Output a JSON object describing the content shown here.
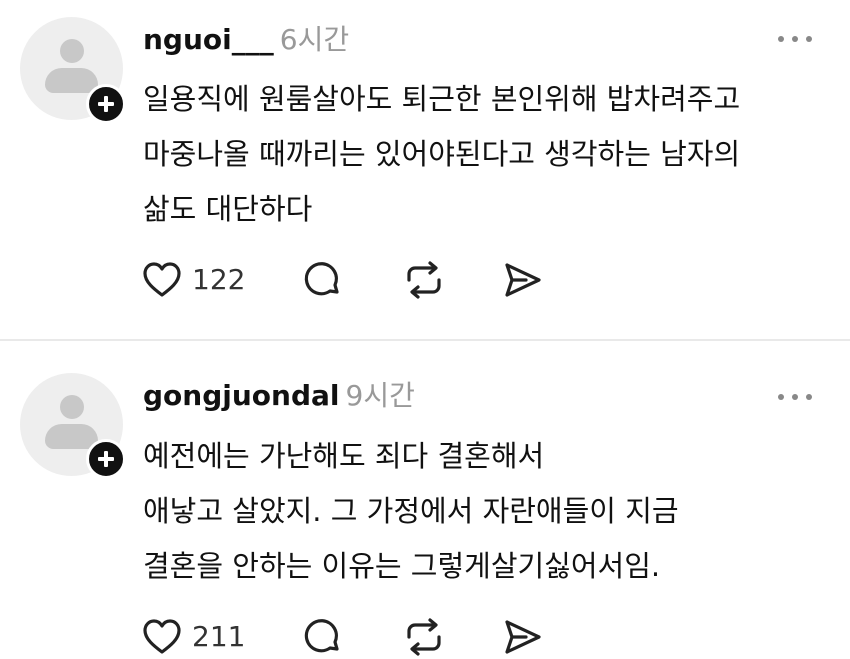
{
  "posts": [
    {
      "username": "nguoi___",
      "time": "6시간",
      "text_lines": [
        "일용직에 원룸살아도 퇴근한 본인위해 밥차려주고",
        "마중나올 때까리는 있어야된다고 생각하는 남자의",
        "삶도 대단하다"
      ],
      "likes": "122"
    },
    {
      "username": "gongjuondal",
      "time": "9시간",
      "text_lines": [
        "예전에는 가난해도 죄다 결혼해서",
        "애낳고 살았지. 그 가정에서 자란애들이 지금",
        "결혼을 안하는 이유는 그렇게살기싫어서임."
      ],
      "likes": "211"
    }
  ],
  "icons": {
    "like": "heart-icon",
    "comment": "comment-bubble-icon",
    "repost": "repost-icon",
    "share": "send-icon",
    "more": "more-dots-icon",
    "follow": "plus-icon",
    "avatar": "default-avatar-icon"
  }
}
